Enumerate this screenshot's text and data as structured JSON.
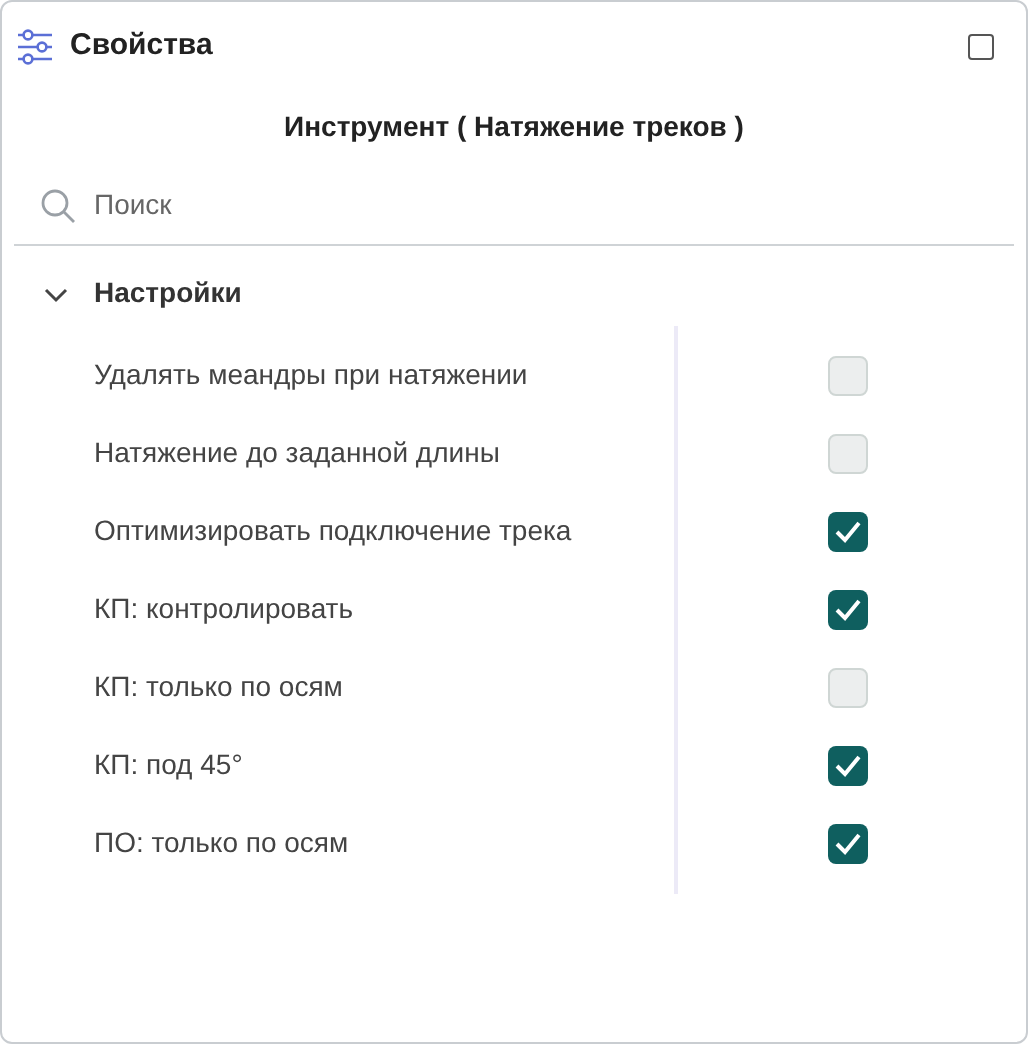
{
  "panel": {
    "title": "Свойства"
  },
  "subtitle": "Инструмент ( Натяжение треков )",
  "search": {
    "placeholder": "Поиск"
  },
  "section": {
    "title": "Настройки",
    "expanded": true,
    "options": [
      {
        "label": "Удалять меандры при натяжении",
        "checked": false
      },
      {
        "label": "Натяжение до заданной длины",
        "checked": false
      },
      {
        "label": "Оптимизировать подключение трека",
        "checked": true
      },
      {
        "label": "КП: контролировать",
        "checked": true
      },
      {
        "label": "КП: только по осям",
        "checked": false
      },
      {
        "label": "КП: под 45°",
        "checked": true
      },
      {
        "label": "ПО: только по осям",
        "checked": true
      }
    ]
  }
}
